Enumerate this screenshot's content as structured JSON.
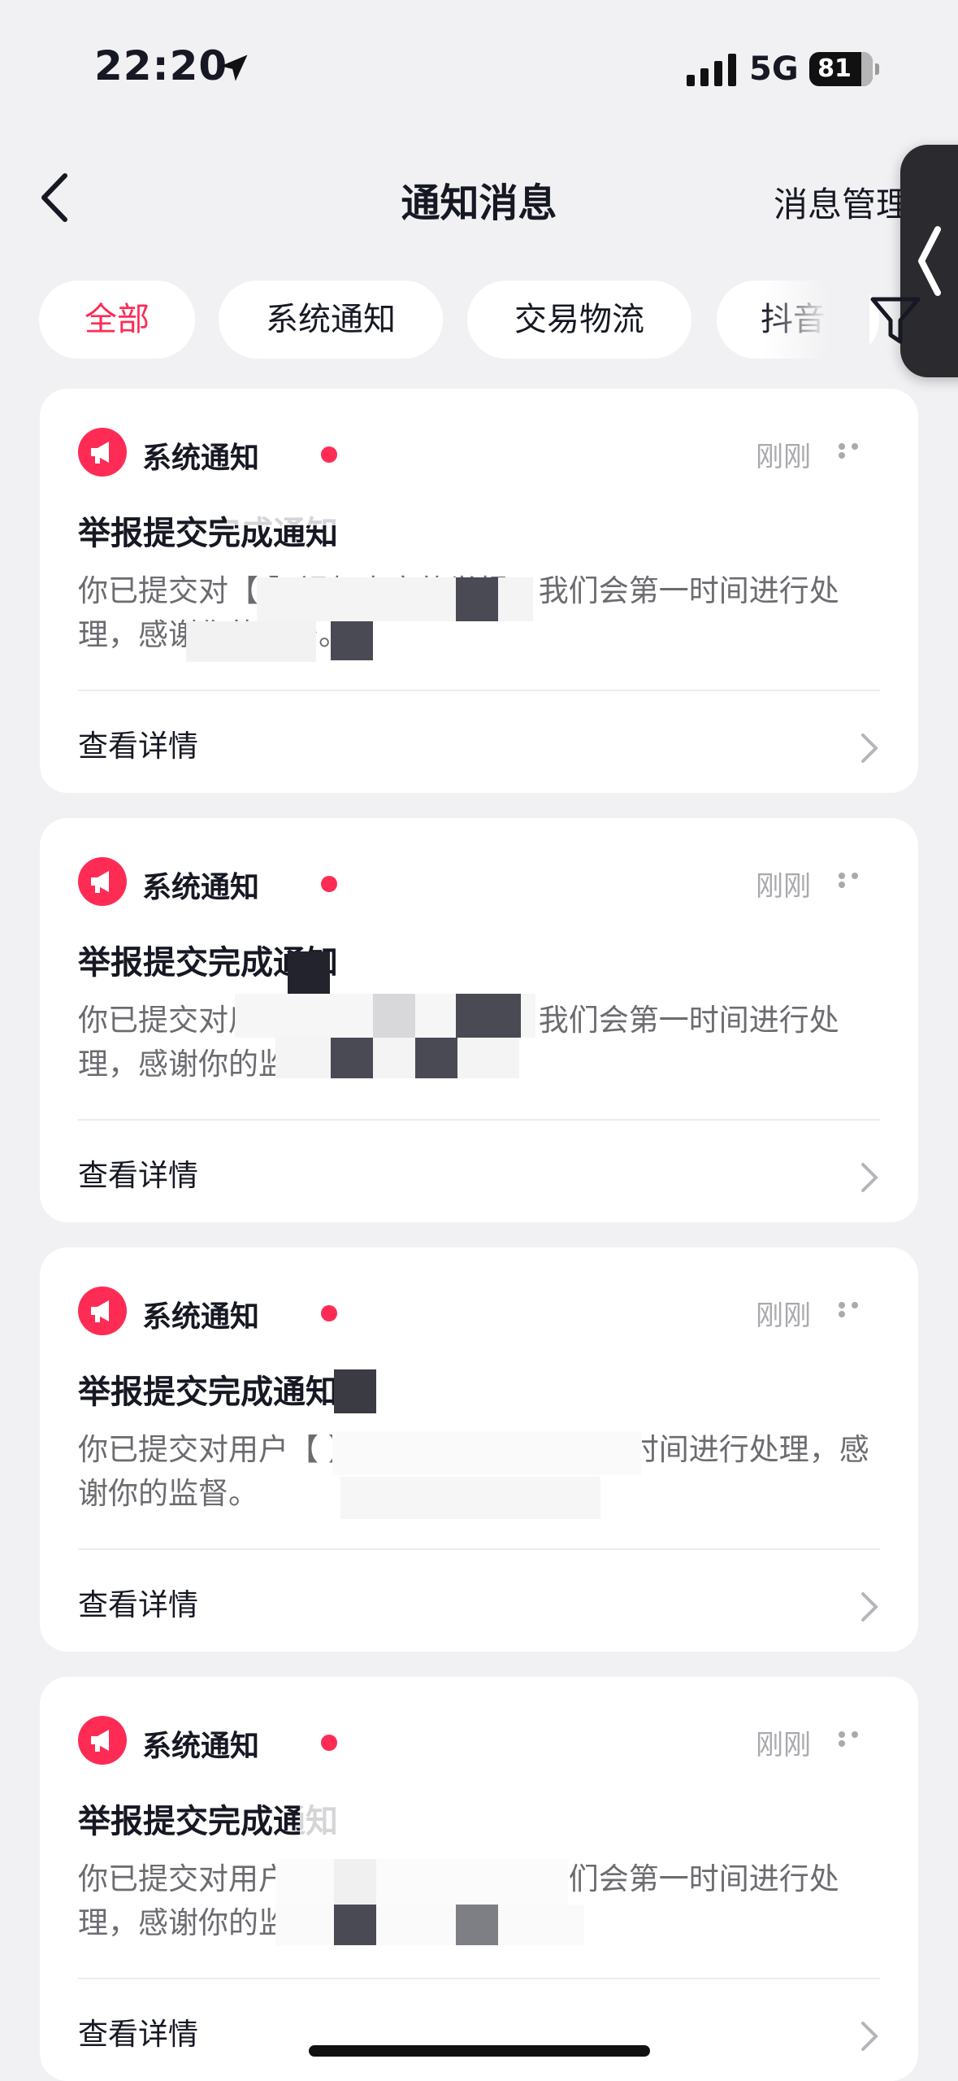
{
  "status_bar": {
    "time": "22:20",
    "network": "5G",
    "battery": "81"
  },
  "nav": {
    "title": "通知消息",
    "manage_label": "消息管理"
  },
  "tabs": [
    {
      "label": "全部",
      "active": true
    },
    {
      "label": "系统通知",
      "active": false
    },
    {
      "label": "交易物流",
      "active": false
    },
    {
      "label": "抖音",
      "active": false
    }
  ],
  "cards": [
    {
      "type": "系统通知",
      "time": "刚刚",
      "title": "举报提交完成通知",
      "body": "你已提交对【                          】视频内容的举报，我们会第一时间进行处理，感谢你的监督。",
      "link": "查看详情"
    },
    {
      "type": "系统通知",
      "time": "刚刚",
      "title": "举报提交完成通知",
      "body": "你已提交对用户【                    】内容的举报，我们会第一时间进行处理，感谢你的监督。",
      "link": "查看详情"
    },
    {
      "type": "系统通知",
      "time": "刚刚",
      "title": "举报提交完成通知",
      "body": "你已提交对用户【                        】的举报，我们会第一时间进行处理，感谢你的监督。",
      "link": "查看详情"
    },
    {
      "type": "系统通知",
      "time": "刚刚",
      "title": "举报提交完成通知",
      "body": "你已提交对用户【                    】内容的举报，我们会第一时间进行处理，感谢你的监督。",
      "link": "查看详情"
    }
  ],
  "colors": {
    "accent": "#fe2c55",
    "background": "#f1f1f3",
    "card": "#ffffff",
    "muted": "#a9a9ae"
  }
}
